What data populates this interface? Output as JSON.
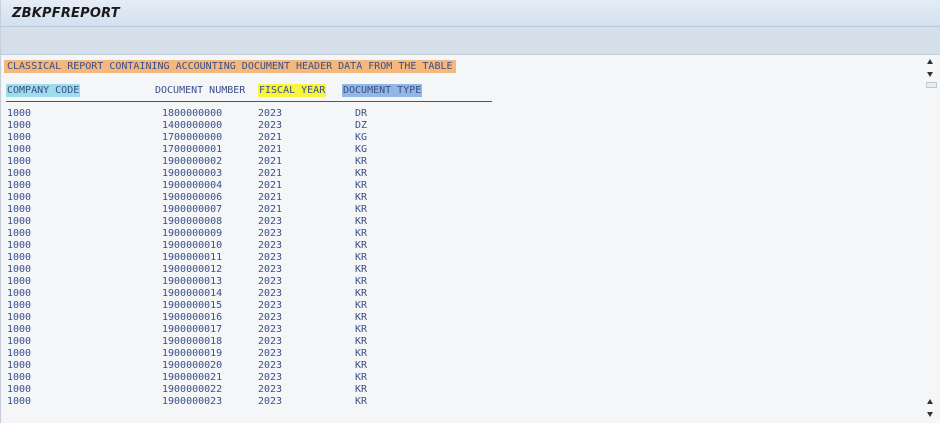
{
  "window": {
    "title": "ZBKPFREPORT"
  },
  "report": {
    "heading": "CLASSICAL REPORT CONTAINING ACCOUNTING DOCUMENT HEADER DATA FROM THE TABLE",
    "columns": {
      "company_code": "COMPANY CODE",
      "document_number": "DOCUMENT NUMBER",
      "fiscal_year": "FISCAL YEAR",
      "document_type": "DOCUMENT TYPE"
    },
    "rows": [
      [
        "1000",
        "1800000000",
        "2023",
        "DR"
      ],
      [
        "1000",
        "1400000000",
        "2023",
        "DZ"
      ],
      [
        "1000",
        "1700000000",
        "2021",
        "KG"
      ],
      [
        "1000",
        "1700000001",
        "2021",
        "KG"
      ],
      [
        "1000",
        "1900000002",
        "2021",
        "KR"
      ],
      [
        "1000",
        "1900000003",
        "2021",
        "KR"
      ],
      [
        "1000",
        "1900000004",
        "2021",
        "KR"
      ],
      [
        "1000",
        "1900000006",
        "2021",
        "KR"
      ],
      [
        "1000",
        "1900000007",
        "2021",
        "KR"
      ],
      [
        "1000",
        "1900000008",
        "2023",
        "KR"
      ],
      [
        "1000",
        "1900000009",
        "2023",
        "KR"
      ],
      [
        "1000",
        "1900000010",
        "2023",
        "KR"
      ],
      [
        "1000",
        "1900000011",
        "2023",
        "KR"
      ],
      [
        "1000",
        "1900000012",
        "2023",
        "KR"
      ],
      [
        "1000",
        "1900000013",
        "2023",
        "KR"
      ],
      [
        "1000",
        "1900000014",
        "2023",
        "KR"
      ],
      [
        "1000",
        "1900000015",
        "2023",
        "KR"
      ],
      [
        "1000",
        "1900000016",
        "2023",
        "KR"
      ],
      [
        "1000",
        "1900000017",
        "2023",
        "KR"
      ],
      [
        "1000",
        "1900000018",
        "2023",
        "KR"
      ],
      [
        "1000",
        "1900000019",
        "2023",
        "KR"
      ],
      [
        "1000",
        "1900000020",
        "2023",
        "KR"
      ],
      [
        "1000",
        "1900000021",
        "2023",
        "KR"
      ],
      [
        "1000",
        "1900000022",
        "2023",
        "KR"
      ],
      [
        "1000",
        "1900000023",
        "2023",
        "KR"
      ]
    ]
  },
  "scrollbar": {
    "up_icon": "arrow-up-icon",
    "down_icon": "arrow-down-icon"
  },
  "colors": {
    "heading_bg": "#f4b77d",
    "company_code_bg": "#9ddcea",
    "fiscal_year_bg": "#f8f53a",
    "document_type_bg": "#93b7e4",
    "text": "#3a4f88"
  }
}
